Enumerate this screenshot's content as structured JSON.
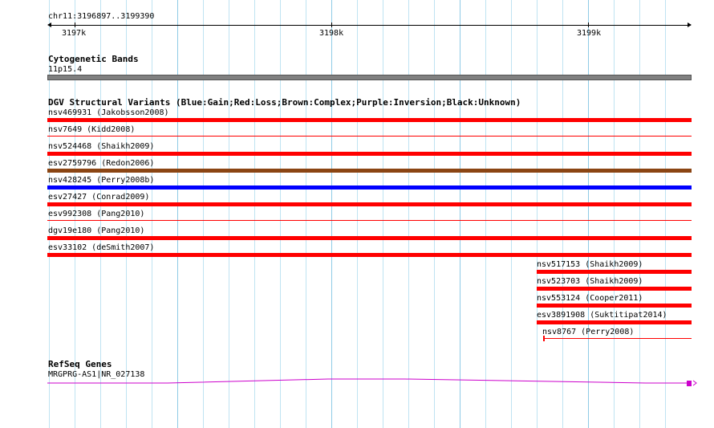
{
  "ruler": {
    "region": "chr11:3196897..3199390",
    "ticks": [
      "3197k",
      "3198k",
      "3199k"
    ]
  },
  "cytoband": {
    "title": "Cytogenetic Bands",
    "band_label": "11p15.4",
    "color": "#808080"
  },
  "dgv": {
    "title": "DGV Structural Variants (Blue:Gain;Red:Loss;Brown:Complex;Purple:Inversion;Black:Unknown)",
    "colors": {
      "loss": "#ff0000",
      "gain": "#0000ff",
      "complex": "#8b4513"
    },
    "features": [
      {
        "label": "nsv469931 (Jakobsson2008)",
        "type": "loss"
      },
      {
        "label": "nsv7649 (Kidd2008)",
        "type": "loss"
      },
      {
        "label": "nsv524468 (Shaikh2009)",
        "type": "loss"
      },
      {
        "label": "esv2759796 (Redon2006)",
        "type": "complex"
      },
      {
        "label": "nsv428245 (Perry2008b)",
        "type": "gain"
      },
      {
        "label": "esv27427 (Conrad2009)",
        "type": "loss"
      },
      {
        "label": "esv992308 (Pang2010)",
        "type": "loss"
      },
      {
        "label": "dgv19e180 (Pang2010)",
        "type": "loss"
      },
      {
        "label": "esv33102 (deSmith2007)",
        "type": "loss"
      },
      {
        "label": "nsv517153 (Shaikh2009)",
        "type": "loss"
      },
      {
        "label": "nsv523703 (Shaikh2009)",
        "type": "loss"
      },
      {
        "label": "nsv553124 (Cooper2011)",
        "type": "loss"
      },
      {
        "label": "esv3891908 (Suktitipat2014)",
        "type": "loss"
      },
      {
        "label": "nsv8767 (Perry2008)",
        "type": "loss"
      }
    ]
  },
  "refseq": {
    "title": "RefSeq Genes",
    "gene_label": "MRGPRG-AS1|NR_027138",
    "color": "#cc00cc"
  }
}
